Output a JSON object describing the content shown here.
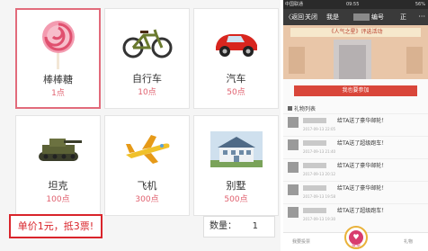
{
  "gifts": [
    {
      "name": "棒棒糖",
      "points": "1点",
      "icon": "lollipop-icon",
      "selected": true
    },
    {
      "name": "自行车",
      "points": "10点",
      "icon": "bicycle-icon",
      "selected": false
    },
    {
      "name": "汽车",
      "points": "50点",
      "icon": "car-icon",
      "selected": false
    },
    {
      "name": "坦克",
      "points": "100点",
      "icon": "tank-icon",
      "selected": false
    },
    {
      "name": "飞机",
      "points": "300点",
      "icon": "airplane-icon",
      "selected": false
    },
    {
      "name": "别墅",
      "points": "500点",
      "icon": "villa-icon",
      "selected": false
    }
  ],
  "price_note": "单价1元，抵3票!",
  "quantity": {
    "label": "数量：",
    "value": "1"
  },
  "phone": {
    "status": {
      "carrier": "中国联通",
      "time": "09:55",
      "battery": "56%"
    },
    "nav": {
      "back": "〈返回",
      "close": "关闭",
      "title_prefix": "我是",
      "title_mid": "编号",
      "title_suffix": "正",
      "menu": "···"
    },
    "banner_text": "《人气之星》评选活动",
    "join_label": "我也要参加",
    "list_title": "礼物列表",
    "rows": [
      {
        "message": "给TA送了豪华邮轮！",
        "time": "2017-09-13 22:05"
      },
      {
        "message": "给TA送了超级跑车！",
        "time": "2017-09-13 21:40"
      },
      {
        "message": "给TA送了豪华邮轮！",
        "time": "2017-09-13 20:12"
      },
      {
        "message": "给TA送了豪华邮轮！",
        "time": "2017-09-13 19:58"
      },
      {
        "message": "给TA送了超级跑车！",
        "time": "2017-09-13 19:30"
      }
    ],
    "tabs": {
      "left": "我要投票",
      "vote": "投票",
      "right": "礼物"
    }
  },
  "colors": {
    "accent_red": "#d9242b",
    "points_pink": "#e0606e",
    "selected_border": "#e26b7b"
  }
}
